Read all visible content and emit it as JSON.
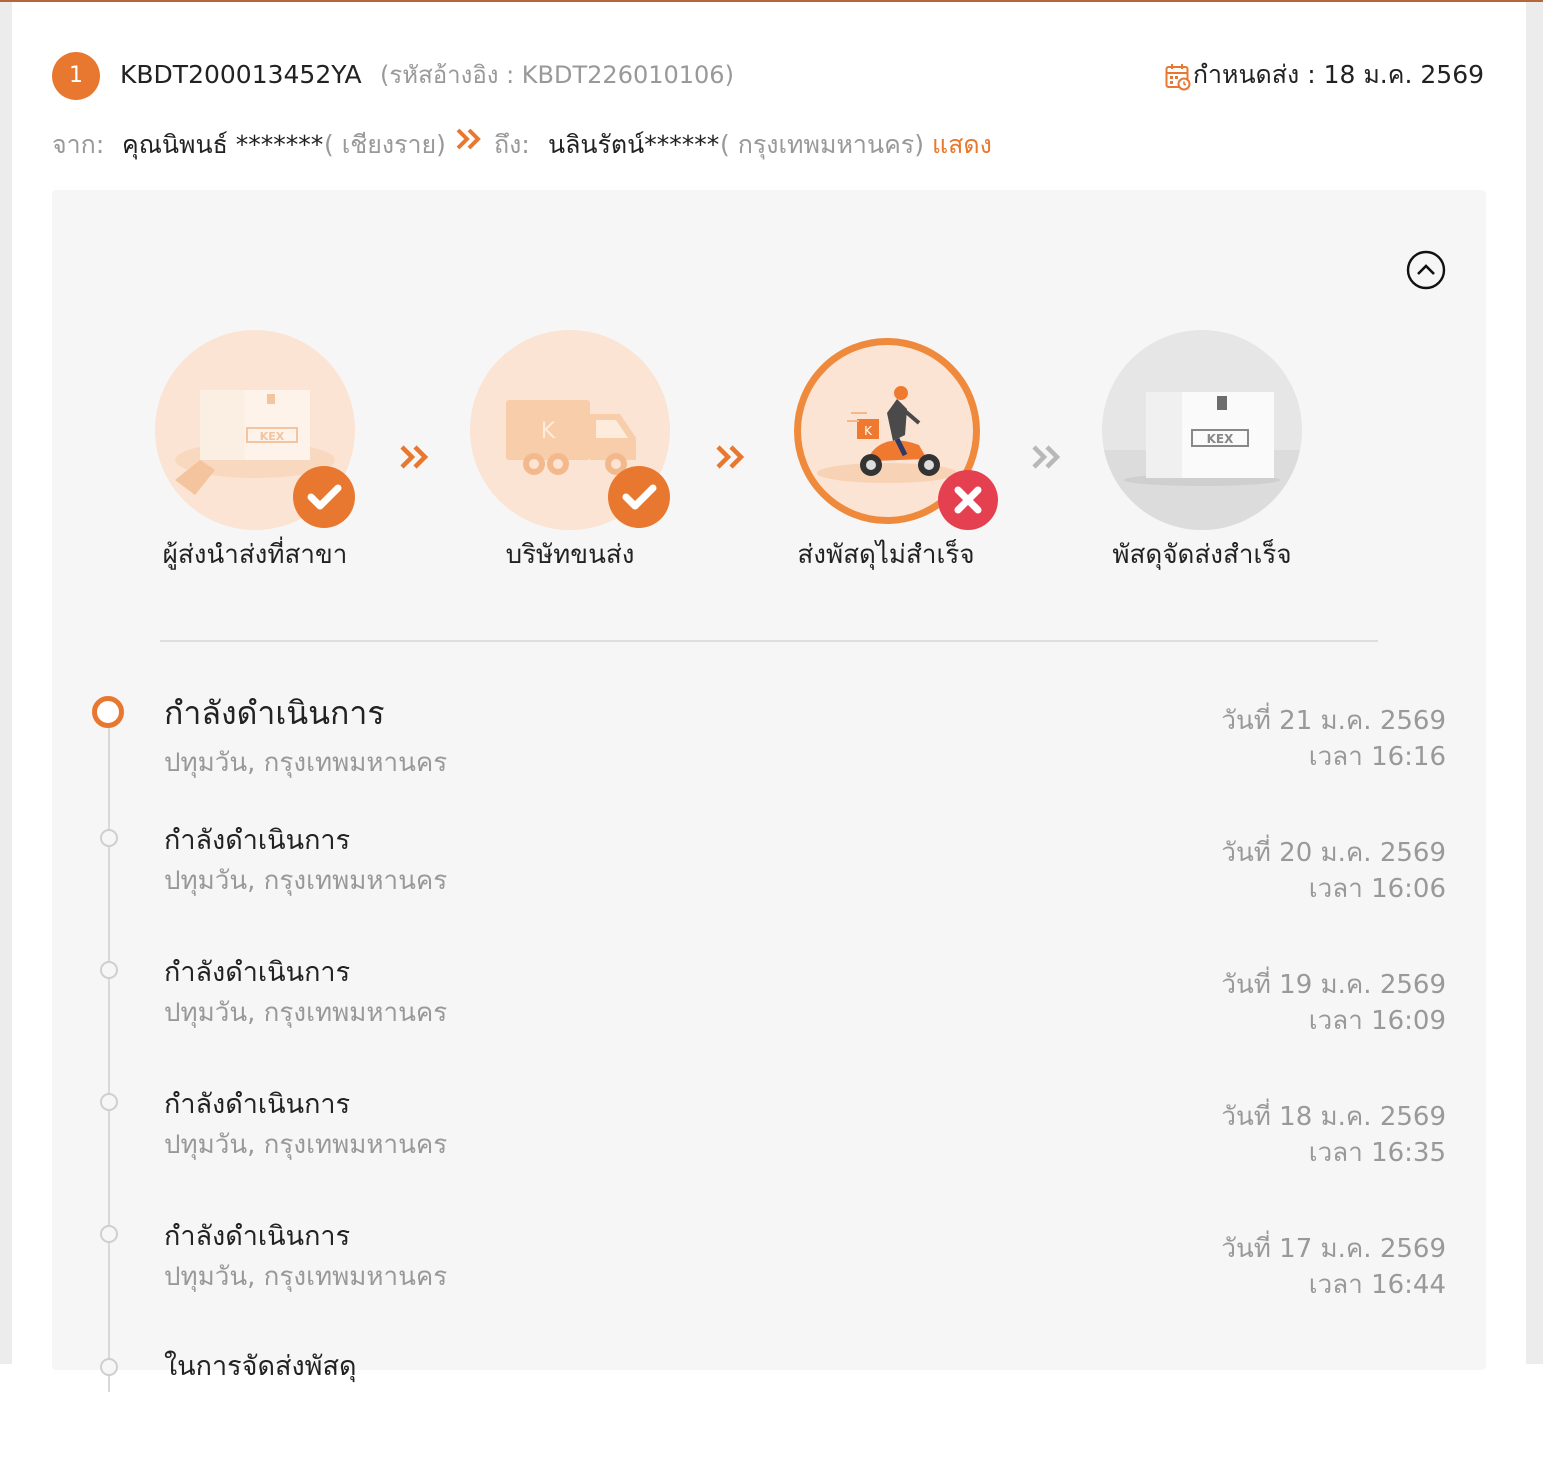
{
  "header": {
    "item_number": "1",
    "tracking_number": "KBDT200013452YA",
    "reference": "(รหัสอ้างอิง : KBDT226010106)",
    "due_label": "กำหนดส่ง : 18 ม.ค. 2569",
    "calendar_icon": "calendar-icon"
  },
  "route": {
    "from_label": "จาก:",
    "sender_name": "คุณนิพนธ์ *******",
    "sender_city": "( เชียงราย)",
    "to_label": "ถึง:",
    "receiver_name": "นลินรัตน์******",
    "receiver_city": "( กรุงเทพมหานคร)",
    "show_link": "แสดง"
  },
  "steps": [
    {
      "label": "ผู้ส่งนำส่งที่สาขา",
      "status": "done"
    },
    {
      "label": "บริษัทขนส่ง",
      "status": "done"
    },
    {
      "label": "ส่งพัสดุไม่สำเร็จ",
      "status": "failed"
    },
    {
      "label": "พัสดุจัดส่งสำเร็จ",
      "status": "pending"
    }
  ],
  "colors": {
    "accent": "#e8782f",
    "fail": "#e4404f",
    "muted": "#999999"
  },
  "timeline": [
    {
      "title": "กำลังดำเนินการ",
      "location": "ปทุมวัน, กรุงเทพมหานคร",
      "date": "วันที่ 21 ม.ค. 2569",
      "time": "เวลา 16:16"
    },
    {
      "title": "กำลังดำเนินการ",
      "location": "ปทุมวัน, กรุงเทพมหานคร",
      "date": "วันที่ 20 ม.ค. 2569",
      "time": "เวลา 16:06"
    },
    {
      "title": "กำลังดำเนินการ",
      "location": "ปทุมวัน, กรุงเทพมหานคร",
      "date": "วันที่ 19 ม.ค. 2569",
      "time": "เวลา 16:09"
    },
    {
      "title": "กำลังดำเนินการ",
      "location": "ปทุมวัน, กรุงเทพมหานคร",
      "date": "วันที่ 18 ม.ค. 2569",
      "time": "เวลา 16:35"
    },
    {
      "title": "กำลังดำเนินการ",
      "location": "ปทุมวัน, กรุงเทพมหานคร",
      "date": "วันที่ 17 ม.ค. 2569",
      "time": "เวลา 16:44"
    },
    {
      "title": "ในการจัดส่งพัสดุ"
    }
  ]
}
